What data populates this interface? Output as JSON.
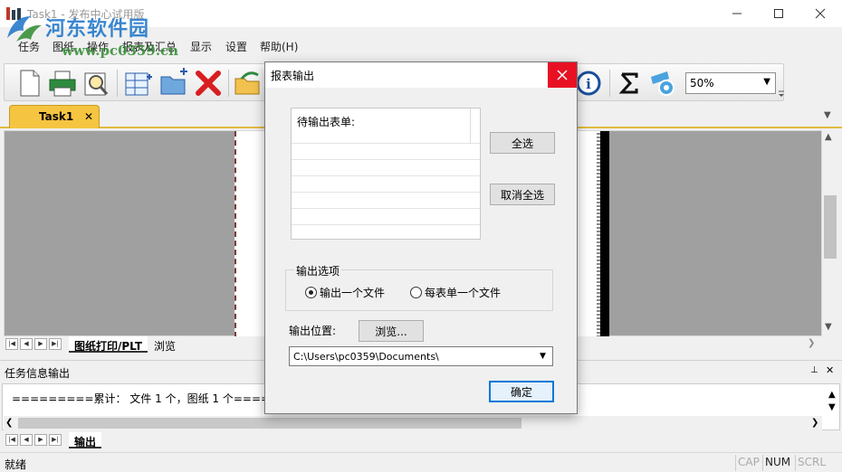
{
  "window": {
    "title": "Task1 - 发布中心试用版",
    "watermark_name": "河东软件园",
    "watermark_url": "www.pc0359.cn"
  },
  "menu": [
    "任务",
    "图纸",
    "操作",
    "报表及汇总",
    "显示",
    "设置",
    "帮助(H)"
  ],
  "toolbar": {
    "zoom": "50%"
  },
  "tabs": {
    "active": "Task1"
  },
  "sheet_tabs": [
    "图纸打印/PLT",
    "浏览"
  ],
  "output_panel": {
    "title": "任务信息输出",
    "line": "=========累计： 文件 1 个，图纸 1 个=====",
    "tab": "输出"
  },
  "statusbar": {
    "text": "就绪",
    "cap": "CAP",
    "num": "NUM",
    "scrl": "SCRL"
  },
  "dialog": {
    "title": "报表输出",
    "list_header": "待输出表单:",
    "select_all": "全选",
    "deselect_all": "取消全选",
    "options_legend": "输出选项",
    "radio_one": "输出一个文件",
    "radio_each": "每表单一个文件",
    "radio_selected": "radio_one",
    "location_label": "输出位置:",
    "browse": "浏览...",
    "path": "C:\\Users\\pc0359\\Documents\\",
    "ok": "确定"
  },
  "colors": {
    "accent_tab": "#f5c542",
    "dialog_close": "#e81123",
    "watermark_blue": "#1a73c8",
    "watermark_green": "#2e8b2e"
  }
}
